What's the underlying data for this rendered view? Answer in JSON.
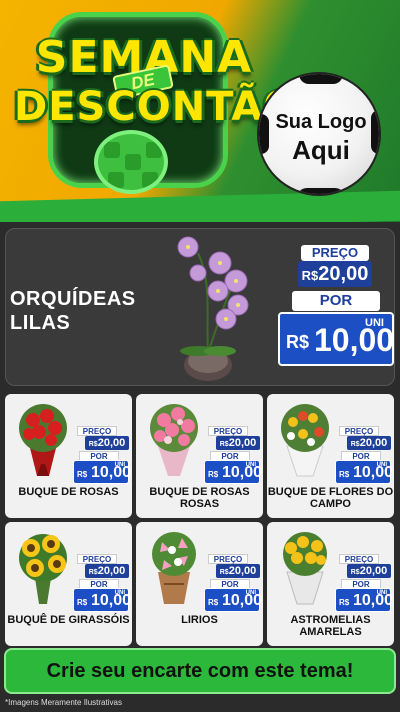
{
  "header": {
    "title_line1": "SEMANA",
    "title_tag": "DE",
    "title_line2": "DESCONTÃO",
    "logo_line1": "Sua Logo",
    "logo_line2": "Aqui",
    "colors": {
      "yellow": "#f5b400",
      "green": "#2f8f2f",
      "title_text": "#ffe600"
    }
  },
  "hero": {
    "name_line1": "ORQUÍDEAS",
    "name_line2": "LILAS",
    "image_icon": "orchid-plant-image",
    "price_label": "PREÇO",
    "old_currency": "R$",
    "old_price": "20,00",
    "por_label": "POR",
    "new_currency": "R$",
    "new_price": "10,00",
    "unit": "UNI"
  },
  "products": [
    {
      "name": "BUQUE DE ROSAS",
      "image_icon": "red-roses-bouquet-image",
      "price_label": "PREÇO",
      "old_currency": "R$",
      "old_price": "20,00",
      "por_label": "POR",
      "new_currency": "R$",
      "new_price": "10,00",
      "unit": "UNI"
    },
    {
      "name": "BUQUE DE ROSAS ROSAS",
      "image_icon": "pink-roses-bouquet-image",
      "price_label": "PREÇO",
      "old_currency": "R$",
      "old_price": "20,00",
      "por_label": "POR",
      "new_currency": "R$",
      "new_price": "10,00",
      "unit": "UNI"
    },
    {
      "name": "BUQUE DE FLORES DO CAMPO",
      "image_icon": "field-flowers-bouquet-image",
      "price_label": "PREÇO",
      "old_currency": "R$",
      "old_price": "20,00",
      "por_label": "POR",
      "new_currency": "R$",
      "new_price": "10,00",
      "unit": "UNI"
    },
    {
      "name": "BUQUÊ DE GIRASSÓIS",
      "image_icon": "sunflower-bouquet-image",
      "price_label": "PREÇO",
      "old_currency": "R$",
      "old_price": "20,00",
      "por_label": "POR",
      "new_currency": "R$",
      "new_price": "10,00",
      "unit": "UNI"
    },
    {
      "name": "LIRIOS",
      "image_icon": "lilies-bouquet-image",
      "price_label": "PREÇO",
      "old_currency": "R$",
      "old_price": "20,00",
      "por_label": "POR",
      "new_currency": "R$",
      "new_price": "10,00",
      "unit": "UNI"
    },
    {
      "name": "ASTROMELIAS AMARELAS",
      "image_icon": "yellow-alstroemeria-bouquet-image",
      "price_label": "PREÇO",
      "old_currency": "R$",
      "old_price": "20,00",
      "por_label": "POR",
      "new_currency": "R$",
      "new_price": "10,00",
      "unit": "UNI"
    }
  ],
  "footer": {
    "cta_label": "Crie seu encarte com este tema!",
    "disclaimer": "*Imagens Meramente Ilustrativas",
    "colors": {
      "cta_bg": "#2cb83a",
      "price_blue": "#1d4fc4"
    }
  }
}
